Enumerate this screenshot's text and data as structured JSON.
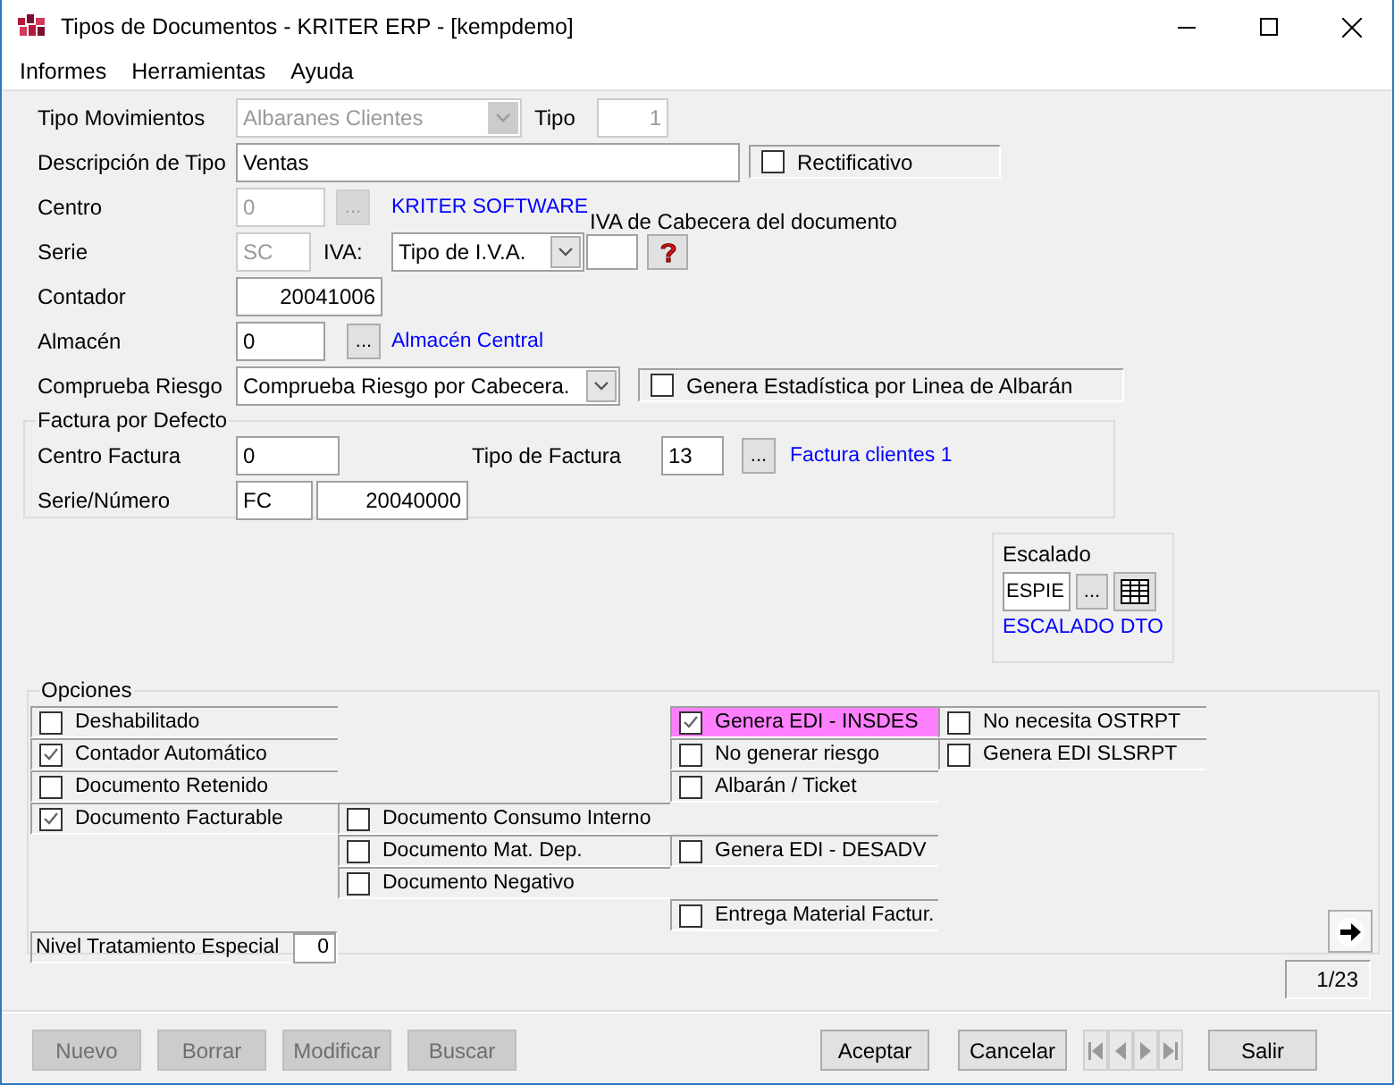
{
  "window": {
    "title": "Tipos de Documentos - KRITER ERP - [kempdemo]"
  },
  "menu": [
    "Informes",
    "Herramientas",
    "Ayuda"
  ],
  "form": {
    "tipo_movimientos": {
      "label": "Tipo Movimientos",
      "value": "Albaranes Clientes",
      "disabled": true
    },
    "tipo": {
      "label": "Tipo",
      "value": "1",
      "disabled": true
    },
    "descripcion": {
      "label": "Descripción de Tipo",
      "value": "Ventas"
    },
    "rectificativo": {
      "label": "Rectificativo",
      "checked": false
    },
    "centro": {
      "label": "Centro",
      "value": "0",
      "disabled": true,
      "browse": {
        "label": "...",
        "disabled": true
      },
      "link": "KRITER SOFTWARE"
    },
    "serie": {
      "label": "Serie",
      "value": "SC",
      "disabled": true
    },
    "iva": {
      "label": "IVA:",
      "value": "Tipo de I.V.A."
    },
    "iva_cabecera": {
      "label": "IVA de Cabecera del documento"
    },
    "contador": {
      "label": "Contador",
      "value": "20041006"
    },
    "almacen": {
      "label": "Almacén",
      "value": "0",
      "browse": {
        "label": "...",
        "disabled": false
      },
      "link": "Almacén Central"
    },
    "comprueba_riesgo": {
      "label": "Comprueba Riesgo",
      "value": "Comprueba Riesgo por Cabecera."
    },
    "genera_estadistica": {
      "label": "Genera Estadística por Linea de Albarán",
      "checked": false
    }
  },
  "factura_por_defecto": {
    "title": "Factura por Defecto",
    "centro_factura": {
      "label": "Centro Factura",
      "value": "0"
    },
    "tipo_factura": {
      "label": "Tipo de Factura",
      "value": "13",
      "browse": {
        "label": "...",
        "disabled": false
      },
      "link": "Factura clientes 1"
    },
    "serie_numero": {
      "label": "Serie/Número",
      "serie": "FC",
      "numero": "20040000"
    }
  },
  "escalado": {
    "label": "Escalado",
    "value": "ESPIE",
    "browse": {
      "label": "...",
      "disabled": false
    },
    "link": "ESCALADO DTO"
  },
  "opciones": {
    "title": "Opciones",
    "columns": [
      [
        {
          "label": "Deshabilitado",
          "checked": false,
          "focused": false
        },
        {
          "label": "Contador Automático",
          "checked": true,
          "focused": false
        },
        {
          "label": "Documento Retenido",
          "checked": false,
          "focused": false
        },
        {
          "label": "Documento Facturable",
          "checked": true,
          "focused": false
        }
      ],
      [
        {
          "label": "Documento Consumo Interno",
          "checked": false,
          "focused": false
        },
        {
          "label": "Documento Mat. Dep.",
          "checked": false,
          "focused": false
        },
        {
          "label": "Documento Negativo",
          "checked": false,
          "focused": false
        }
      ],
      [
        {
          "label": "Genera EDI - INSDES",
          "checked": true,
          "focused": true
        },
        {
          "label": "No generar riesgo",
          "checked": false,
          "focused": false
        },
        {
          "label": "Albarán / Ticket",
          "checked": false,
          "focused": false
        },
        {
          "label": "Genera EDI - DESADV",
          "checked": false,
          "focused": false
        },
        {
          "label": "Entrega Material Factur.",
          "checked": false,
          "focused": false
        }
      ],
      [
        {
          "label": "No necesita OSTRPT",
          "checked": false,
          "focused": false
        },
        {
          "label": "Genera EDI SLSRPT",
          "checked": false,
          "focused": false
        }
      ]
    ],
    "nivel": {
      "label": "Nivel Tratamiento Especial",
      "value": "0"
    }
  },
  "record_counter": "1/23",
  "actions": [
    {
      "label": "Nuevo",
      "disabled": true
    },
    {
      "label": "Borrar",
      "disabled": true
    },
    {
      "label": "Modificar",
      "disabled": true
    },
    {
      "label": "Buscar",
      "disabled": true
    }
  ],
  "dialog_buttons": [
    {
      "label": "Aceptar",
      "disabled": false
    },
    {
      "label": "Cancelar",
      "disabled": false
    }
  ],
  "exit_button": {
    "label": "Salir",
    "disabled": false
  }
}
